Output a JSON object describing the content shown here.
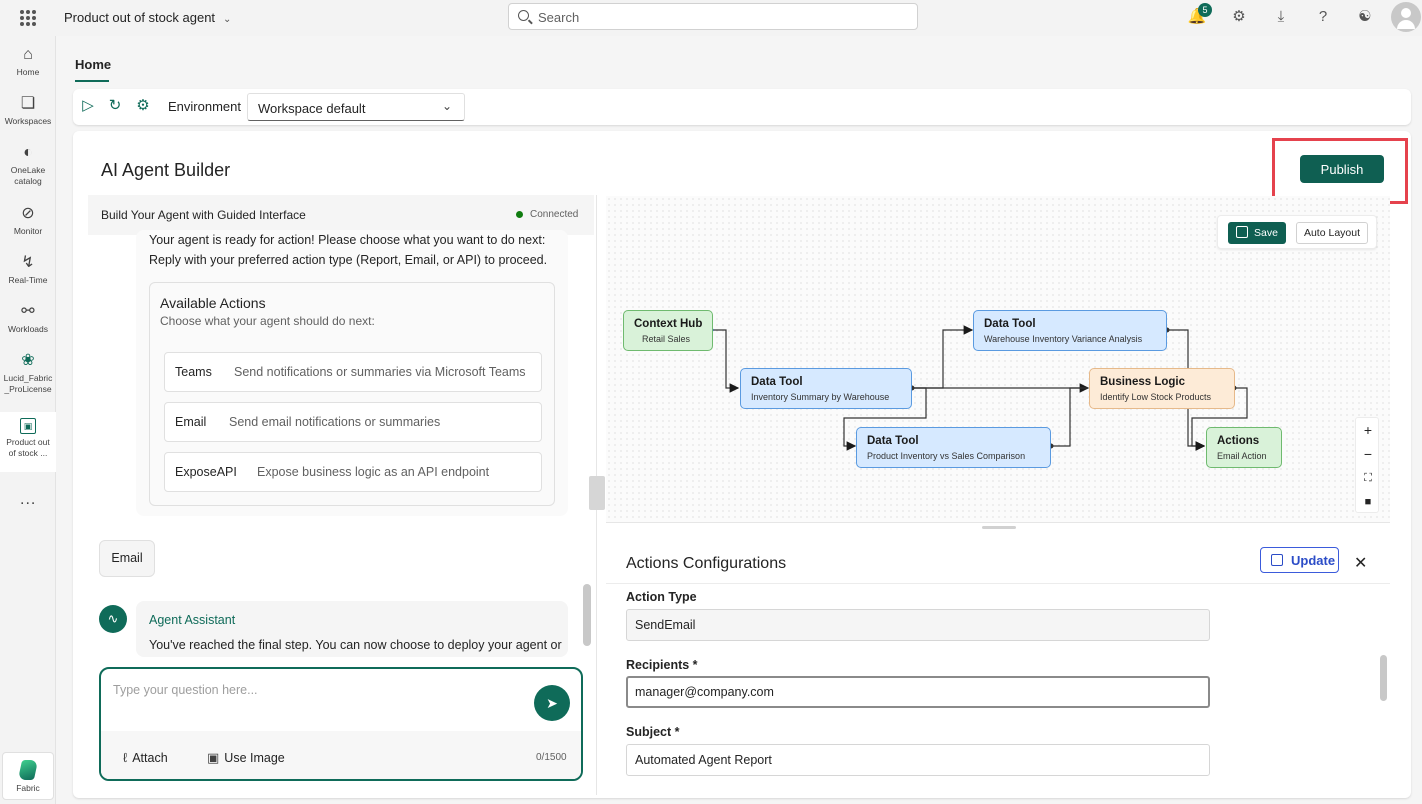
{
  "topbar": {
    "app_title": "Product out of stock agent",
    "search_placeholder": "Search",
    "notification_count": "5"
  },
  "rail": {
    "items": [
      {
        "label": "Home",
        "icon": "home-icon"
      },
      {
        "label": "Workspaces",
        "icon": "workspaces-icon"
      },
      {
        "label": "OneLake catalog",
        "icon": "onelake-icon"
      },
      {
        "label": "Monitor",
        "icon": "monitor-icon"
      },
      {
        "label": "Real-Time",
        "icon": "lightning-icon"
      },
      {
        "label": "Workloads",
        "icon": "workloads-icon"
      },
      {
        "label": "Lucid_Fabric _ProLicense",
        "icon": "workspace-people-icon"
      },
      {
        "label": "Product out of stock ...",
        "icon": "agent-item-icon"
      }
    ],
    "more": "...",
    "fabric_label": "Fabric"
  },
  "tabs": {
    "home": "Home"
  },
  "toolbar": {
    "environment_label": "Environment",
    "environment_value": "Workspace default"
  },
  "builder": {
    "title": "AI Agent Builder",
    "publish_label": "Publish"
  },
  "chat": {
    "header_title": "Build Your Agent with Guided Interface",
    "status": "Connected",
    "intro_line1": "Your agent is ready for action! Please choose what you want to do next:",
    "intro_line2": "Reply with your preferred action type (Report, Email, or API) to proceed.",
    "actions_title": "Available Actions",
    "actions_subtitle": "Choose what your agent should do next:",
    "actions": [
      {
        "name": "Teams",
        "desc": "Send notifications or summaries via Microsoft Teams"
      },
      {
        "name": "Email",
        "desc": "Send email notifications or summaries"
      },
      {
        "name": "ExposeAPI",
        "desc": "Expose business logic as an API endpoint"
      }
    ],
    "user_reply": "Email",
    "agent_name": "Agent Assistant",
    "agent_message": "You've reached the final step. You can now choose to deploy your agent or",
    "input_placeholder": "Type your question here...",
    "attach_label": "Attach",
    "use_image_label": "Use Image",
    "char_counter": "0/1500"
  },
  "canvas": {
    "save_label": "Save",
    "auto_layout_label": "Auto Layout",
    "nodes": {
      "context_hub": {
        "title": "Context Hub",
        "subtitle": "Retail Sales"
      },
      "inv_summary": {
        "title": "Data Tool",
        "subtitle": "Inventory Summary by Warehouse"
      },
      "variance": {
        "title": "Data Tool",
        "subtitle": "Warehouse Inventory Variance Analysis"
      },
      "vs_sales": {
        "title": "Data Tool",
        "subtitle": "Product Inventory vs Sales Comparison"
      },
      "business_logic": {
        "title": "Business Logic",
        "subtitle": "Identify Low Stock Products"
      },
      "actions": {
        "title": "Actions",
        "subtitle": "Email Action"
      }
    }
  },
  "config": {
    "title": "Actions Configurations",
    "update_label": "Update",
    "action_type_label": "Action Type",
    "action_type_value": "SendEmail",
    "recipients_label": "Recipients *",
    "recipients_value": "manager@company.com",
    "subject_label": "Subject *",
    "subject_value": "Automated Agent Report"
  },
  "colors": {
    "accent": "#0f6b59",
    "publish_highlight": "#e5424d",
    "update_blue": "#2b4cc7"
  }
}
